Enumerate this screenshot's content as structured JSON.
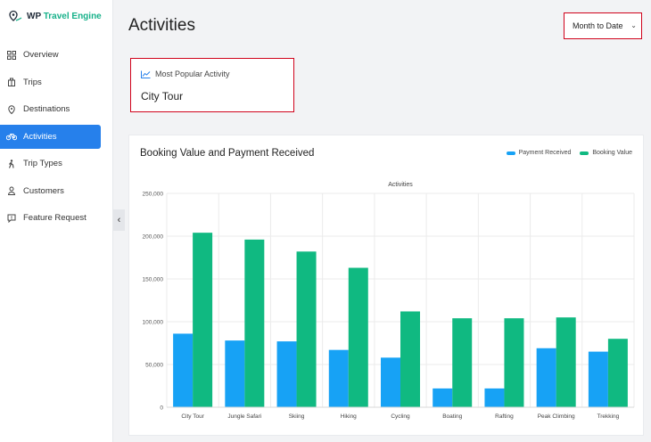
{
  "brand": {
    "name_part1": "WP",
    "name_part2": "Travel Engine"
  },
  "sidebar": {
    "items": [
      {
        "label": "Overview",
        "icon": "grid-icon",
        "active": false
      },
      {
        "label": "Trips",
        "icon": "briefcase-icon",
        "active": false
      },
      {
        "label": "Destinations",
        "icon": "map-pin-icon",
        "active": false
      },
      {
        "label": "Activities",
        "icon": "bicycle-icon",
        "active": true
      },
      {
        "label": "Trip Types",
        "icon": "hiker-icon",
        "active": false
      },
      {
        "label": "Customers",
        "icon": "user-icon",
        "active": false
      },
      {
        "label": "Feature Request",
        "icon": "chat-icon",
        "active": false
      }
    ],
    "collapse_glyph": "‹"
  },
  "header": {
    "title": "Activities",
    "date_range": "Month to Date",
    "chevron": "⌄"
  },
  "popular": {
    "label": "Most Popular Activity",
    "value": "City Tour"
  },
  "chart_card": {
    "title": "Booking Value and Payment Received",
    "legend": [
      "Payment Received",
      "Booking Value"
    ]
  },
  "colors": {
    "accent": "#2680eb",
    "payment": "#17a2f5",
    "booking": "#10b981",
    "highlight": "#d0021b"
  },
  "chart_data": {
    "type": "bar",
    "title": "Activities",
    "xlabel": "",
    "ylabel": "",
    "categories": [
      "City Tour",
      "Jungle Safari",
      "Skiing",
      "Hiking",
      "Cycling",
      "Boating",
      "Rafting",
      "Peak Climbing",
      "Trekking"
    ],
    "series": [
      {
        "name": "Payment Received",
        "values": [
          86000,
          78000,
          77000,
          67000,
          58000,
          22000,
          22000,
          69000,
          65000
        ]
      },
      {
        "name": "Booking Value",
        "values": [
          204000,
          196000,
          182000,
          163000,
          112000,
          104000,
          104000,
          105000,
          80000
        ]
      }
    ],
    "ylim": [
      0,
      250000
    ],
    "yticks": [
      "0",
      "50,000",
      "100,000",
      "150,000",
      "200,000",
      "250,000"
    ],
    "grid": true,
    "legend_position": "top-right"
  }
}
